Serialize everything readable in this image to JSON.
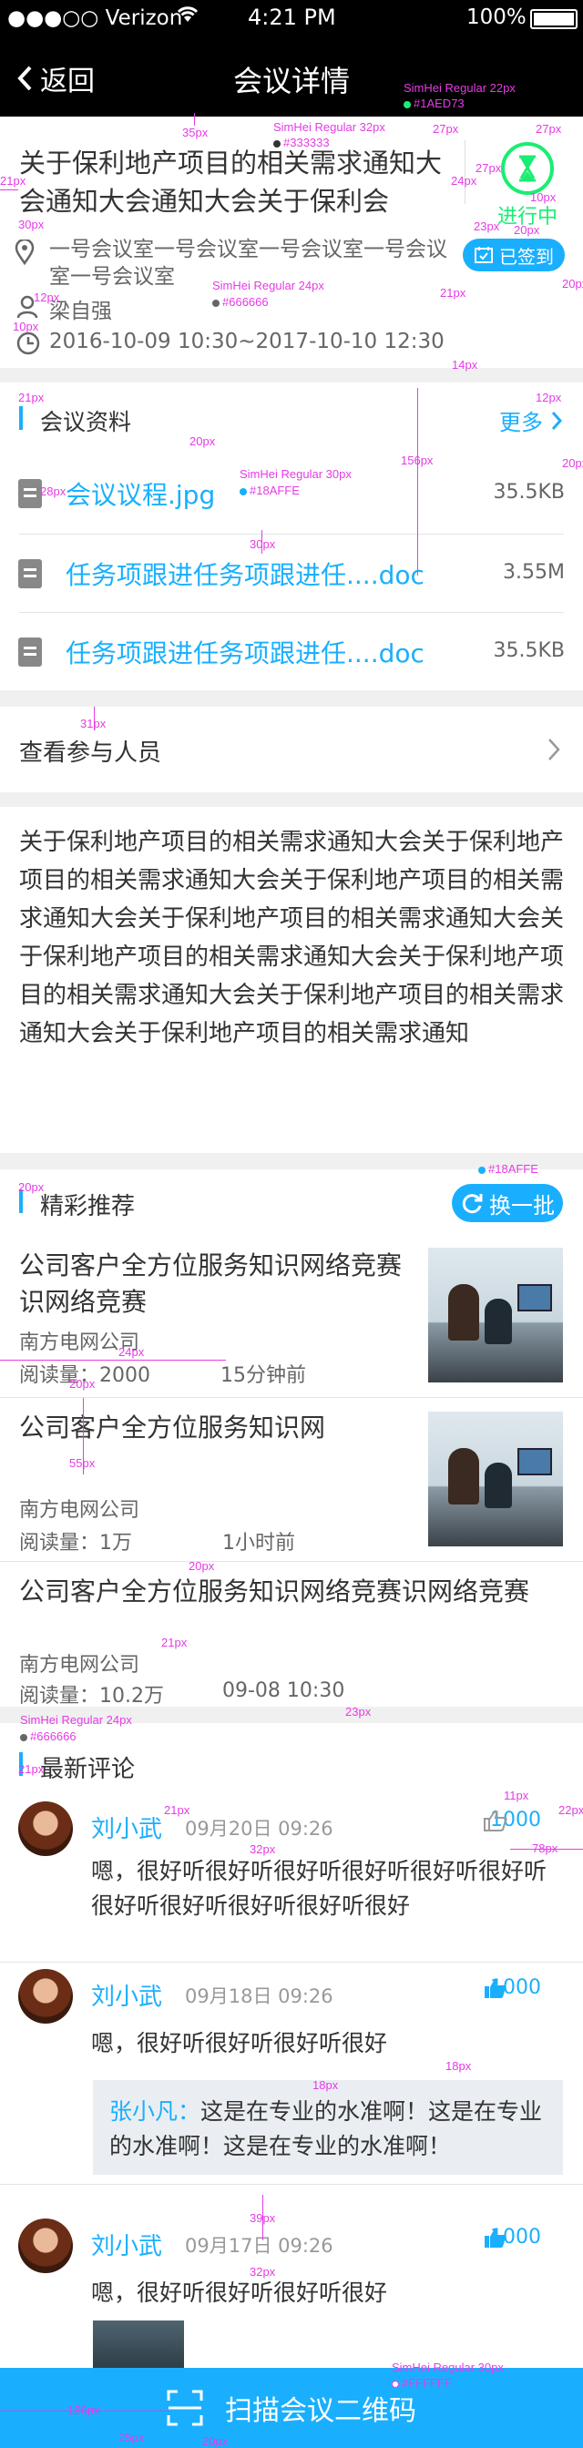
{
  "status": {
    "carrier": "●●●○○ Verizon",
    "time": "4:21 PM",
    "battery": "100%"
  },
  "nav": {
    "back": "返回",
    "title": "会议详情"
  },
  "meeting": {
    "title": "关于保利地产项目的相关需求通知大会通知大会通知大会关于保利会",
    "status": "进行中",
    "signed": "已签到",
    "room": "一号会议室一号会议室一号会议室一号会议室一号会议室",
    "host": "梁自强",
    "time": "2016-10-09 10:30~2017-10-10 12:30"
  },
  "materials": {
    "heading": "会议资料",
    "more": "更多",
    "files": [
      {
        "name": "会议议程.jpg",
        "size": "35.5KB"
      },
      {
        "name": "任务项跟进任务项跟进任....doc",
        "size": "3.55M"
      },
      {
        "name": "任务项跟进任务项跟进任....doc",
        "size": "35.5KB"
      }
    ]
  },
  "participants": {
    "label": "查看参与人员"
  },
  "description": "关于保利地产项目的相关需求通知大会关于保利地产项目的相关需求通知大会关于保利地产项目的相关需求通知大会关于保利地产项目的相关需求通知大会关于保利地产项目的相关需求通知大会关于保利地产项目的相关需求通知大会关于保利地产项目的相关需求通知大会关于保利地产项目的相关需求通知",
  "recommend": {
    "heading": "精彩推荐",
    "refresh": "换一批",
    "items": [
      {
        "title": "公司客户全方位服务知识网络竞赛识网络竞赛",
        "source": "南方电网公司",
        "reads": "阅读量：2000",
        "time": "15分钟前"
      },
      {
        "title": "公司客户全方位服务知识网",
        "source": "南方电网公司",
        "reads": "阅读量：1万",
        "time": "1小时前"
      },
      {
        "title": "公司客户全方位服务知识网络竞赛识网络竞赛",
        "source": "南方电网公司",
        "reads": "阅读量：10.2万",
        "time": "09-08 10:30"
      }
    ]
  },
  "comments": {
    "heading": "最新评论",
    "items": [
      {
        "name": "刘小武",
        "date": "09月20日  09:26",
        "likes": "1000",
        "text": "嗯，很好听很好听很好听很好听很好听很好听很好听很好听很好听很好听很好"
      },
      {
        "name": "刘小武",
        "date": "09月18日  09:26",
        "likes": "1000",
        "text": "嗯，很好听很好听很好听很好",
        "reply_name": "张小凡：",
        "reply_text": "这是在专业的水准啊！这是在专业的水准啊！这是在专业的水准啊！"
      },
      {
        "name": "刘小武",
        "date": "09月17日  09:26",
        "likes": "1000",
        "text": "嗯，很好听很好听很好听很好"
      }
    ]
  },
  "scan": {
    "label": "扫描会议二维码"
  },
  "annotations": {
    "a_simhei22": "SimHei Regular 22px",
    "a_c1aed73": "#1AED73",
    "a_simhei32": "SimHei Regular 32px",
    "a_c333": "#333333",
    "a_simhei24": "SimHei Regular 24px",
    "a_c666": "#666666",
    "a_simhei30": "SimHei Regular 30px",
    "a_c18a": "#18AFFE",
    "a_c18b": "#18AFFE",
    "a_simhei24b": "SimHei Regular 24px",
    "a_c666b": "#666666",
    "a_simhei30b": "SimHei Regular 30px",
    "a_cfff": "#FFFFFF",
    "m35": "35px",
    "m27a": "27px",
    "m27b": "27px",
    "m21a": "21px",
    "m30a": "30px",
    "m24a": "24px",
    "m10a": "10px",
    "m23": "23px",
    "m20a": "20px",
    "m12a": "12px",
    "m21b": "21px",
    "m20b": "20px",
    "m10b": "10px",
    "m14": "14px",
    "m21c": "21px",
    "m12b": "12px",
    "m20c": "20px",
    "m156": "156px",
    "m20d": "20px",
    "m28": "28px",
    "m30b": "30px",
    "m31": "31px",
    "m20e": "20px",
    "m24b": "24px",
    "m20f": "20px",
    "m55": "55px",
    "m20g": "20px",
    "m21d": "21px",
    "m23b": "23px",
    "m21e": "21px",
    "m21f": "21px",
    "m32a": "32px",
    "m11": "11px",
    "m22": "22px",
    "m78": "78px",
    "m18a": "18px",
    "m18b": "18px",
    "m39": "39px",
    "m32b": "32px",
    "m186": "186px",
    "m25": "25px",
    "m20h": "20px"
  }
}
